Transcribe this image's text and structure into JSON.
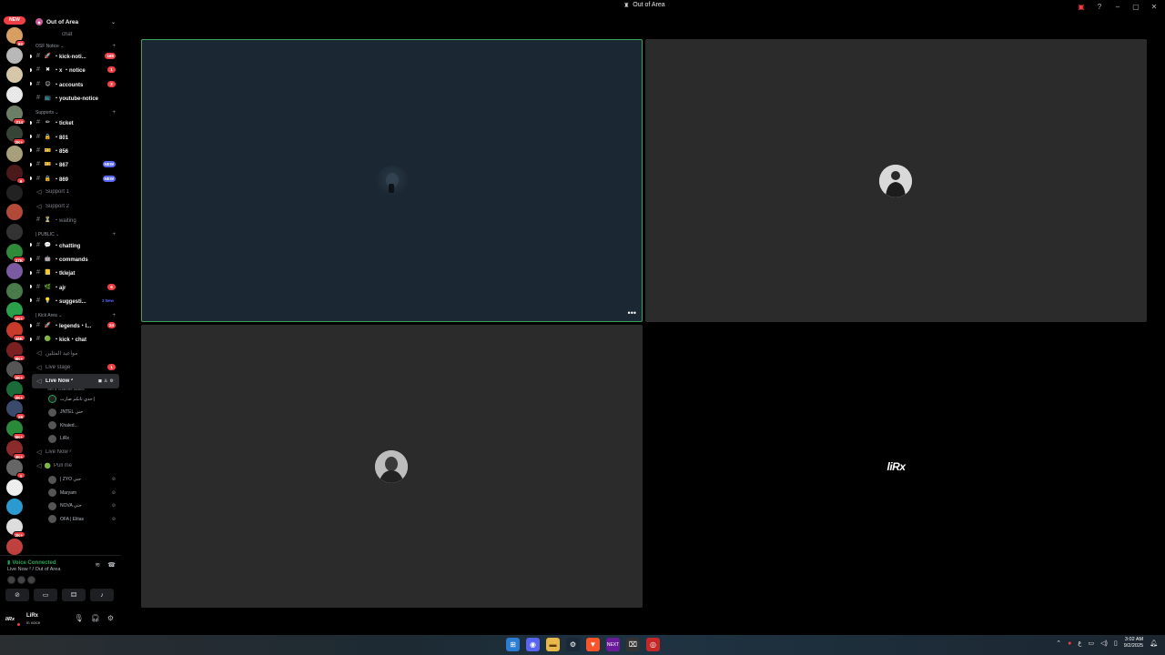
{
  "window": {
    "title": "Out of Area"
  },
  "server_rail": {
    "new_label": "NEW",
    "servers": [
      {
        "badge": "82",
        "color": "#d7a062"
      },
      {
        "badge": "",
        "color": "#b8b8b8"
      },
      {
        "badge": "",
        "color": "#d6c7a8"
      },
      {
        "badge": "",
        "color": "#e8e8e8"
      },
      {
        "badge": "214",
        "color": "#6c7e66"
      },
      {
        "badge": "2K+",
        "color": "#354436"
      },
      {
        "badge": "",
        "color": "#a8a07c"
      },
      {
        "badge": "9",
        "color": "#4a1a1a"
      },
      {
        "badge": "",
        "color": "#222222"
      },
      {
        "badge": "",
        "color": "#b24a3a"
      },
      {
        "badge": "",
        "color": "#333333"
      },
      {
        "badge": "27K",
        "color": "#2f8a3a"
      },
      {
        "badge": "",
        "color": "#7a5aa0"
      },
      {
        "badge": "",
        "color": "#4a7a4a"
      },
      {
        "badge": "1K+",
        "color": "#2aa04a"
      },
      {
        "badge": "46K",
        "color": "#c83a2a"
      },
      {
        "badge": "9K+",
        "color": "#7a2020"
      },
      {
        "badge": "2K+",
        "color": "#555555"
      },
      {
        "badge": "2K+",
        "color": "#1a6a3a"
      },
      {
        "badge": "26",
        "color": "#3a4a6a"
      },
      {
        "badge": "5K+",
        "color": "#2a8a3a"
      },
      {
        "badge": "3K+",
        "color": "#8a2a2a"
      },
      {
        "badge": "1",
        "color": "#666666"
      },
      {
        "badge": "",
        "color": "#eeeeee"
      },
      {
        "badge": "",
        "color": "#2a9ad0"
      },
      {
        "badge": "2K+",
        "color": "#dddddd"
      },
      {
        "badge": "",
        "color": "#c04040"
      }
    ]
  },
  "sidebar": {
    "guild_name": "Out of Area",
    "top_partial": "chat",
    "categories": [
      {
        "label": "OSF Notice",
        "channels": [
          {
            "emoji": "🚀",
            "name": "・kick-noti...",
            "badge": "185",
            "badge_type": "count",
            "unread": true
          },
          {
            "emoji": "✖",
            "name": "・x ・notice",
            "badge": "1",
            "badge_type": "count",
            "unread": true
          },
          {
            "emoji": "😊",
            "name": "・accounts",
            "badge": "2",
            "badge_type": "count",
            "unread": true
          },
          {
            "emoji": "📺",
            "name": "・youtube-notice",
            "badge": "",
            "badge_type": "",
            "unread": false
          }
        ]
      },
      {
        "label": "Supports",
        "channels": [
          {
            "emoji": "✏",
            "name": "・ticket",
            "badge": "",
            "badge_type": "",
            "unread": true
          },
          {
            "emoji": "🔒",
            "name": "・801",
            "badge": "",
            "badge_type": "",
            "unread": true
          },
          {
            "emoji": "🎫",
            "name": "・856",
            "badge": "",
            "badge_type": "",
            "unread": true
          },
          {
            "emoji": "🎫",
            "name": "・867",
            "badge": "NEW",
            "badge_type": "new",
            "unread": true
          },
          {
            "emoji": "🔒",
            "name": "・869",
            "badge": "NEW",
            "badge_type": "new",
            "unread": true
          }
        ],
        "voice": [
          {
            "name": "Support 1"
          },
          {
            "name": "Support 2"
          },
          {
            "emoji": "⏳",
            "name": "・waiting"
          }
        ]
      },
      {
        "label": "| PUBLIC",
        "channels": [
          {
            "emoji": "💬",
            "name": "・chatting",
            "badge": "",
            "badge_type": "",
            "unread": true
          },
          {
            "emoji": "🤖",
            "name": "・commands",
            "badge": "",
            "badge_type": "",
            "unread": true
          },
          {
            "emoji": "📒",
            "name": "・tklejat",
            "badge": "",
            "badge_type": "",
            "unread": true
          },
          {
            "emoji": "🌿",
            "name": "・ajr",
            "badge": "6",
            "badge_type": "count",
            "unread": true
          },
          {
            "emoji": "💡",
            "name": "・suggesti...",
            "badge": "3 New",
            "badge_type": "text-new",
            "unread": true
          }
        ]
      },
      {
        "label": "| Kick Area",
        "channels": [
          {
            "emoji": "🚀",
            "name": "・legends・l...",
            "badge": "24",
            "badge_type": "count",
            "unread": true
          },
          {
            "emoji": "🟢",
            "name": "・kick・chat",
            "badge": "",
            "badge_type": "",
            "unread": true
          }
        ],
        "voice": [
          {
            "name": "مواعيد المثلين"
          },
          {
            "name": "Live stage",
            "badge": "1"
          }
        ]
      }
    ],
    "active_voice": {
      "name": "Live Now ²",
      "status": "Set a channel status",
      "users": [
        {
          "name": "حدي ثانكم صارت |",
          "speaking": true
        },
        {
          "name": "JNTEL حتي",
          "speaking": false
        },
        {
          "name": "Khaled...",
          "speaking": false
        },
        {
          "name": "LiRx",
          "speaking": false
        }
      ]
    },
    "other_voice": {
      "name": "Live Now ²",
      "sub_channel": "Pull me",
      "users": [
        {
          "name": "| ZYO حتي"
        },
        {
          "name": "Maryam"
        },
        {
          "name": "NOVA حتي"
        },
        {
          "name": "OFA | Elitas"
        }
      ]
    }
  },
  "voice_panel": {
    "status": "Voice Connected",
    "location": "Live Now ² / Out of Area"
  },
  "user_panel": {
    "avatar_text": "liRx",
    "name": "LiRx",
    "status": "in voice"
  },
  "stage": {
    "tile4_logo": "liRx",
    "more_label": "•••"
  },
  "taskbar": {
    "lang": "ع",
    "time": "3:02 AM",
    "date": "9/2/2025"
  },
  "colors": {
    "accent_green": "#23a55a",
    "mention_red": "#f23f43",
    "brand_blue": "#5865f2"
  }
}
